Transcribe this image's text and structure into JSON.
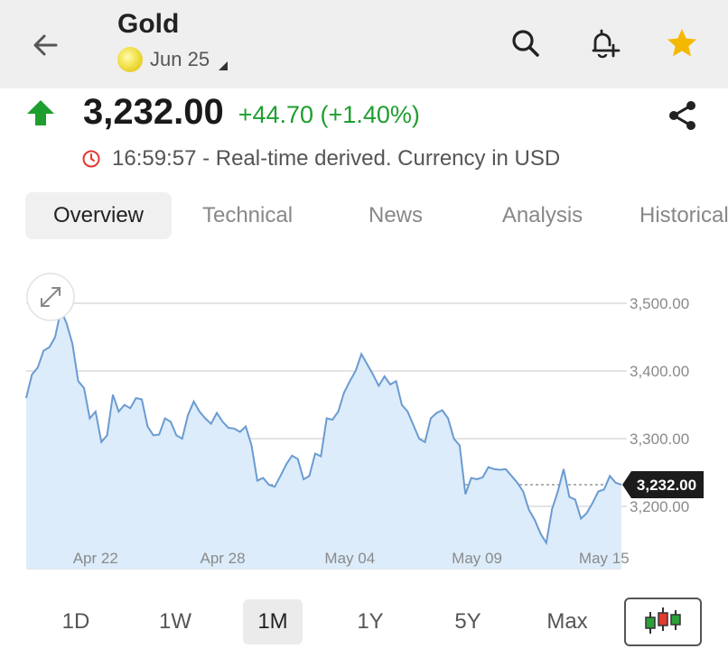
{
  "header": {
    "title": "Gold",
    "contract": "Jun 25",
    "icons": [
      "back-arrow-icon",
      "search-icon",
      "add-alert-icon",
      "star-icon"
    ],
    "star_color": "#f5b800"
  },
  "quote": {
    "price": "3,232.00",
    "change": "+44.70 (+1.40%)",
    "status": "16:59:57 - Real-time derived. Currency in USD",
    "up_color": "#1e9e2f"
  },
  "tabs": [
    {
      "label": "Overview",
      "active": true
    },
    {
      "label": "Technical",
      "active": false
    },
    {
      "label": "News",
      "active": false
    },
    {
      "label": "Analysis",
      "active": false
    },
    {
      "label": "Historical",
      "active": false
    }
  ],
  "ranges": [
    {
      "label": "1D",
      "active": false
    },
    {
      "label": "1W",
      "active": false
    },
    {
      "label": "1M",
      "active": true
    },
    {
      "label": "1Y",
      "active": false
    },
    {
      "label": "5Y",
      "active": false
    },
    {
      "label": "Max",
      "active": false
    }
  ],
  "chart_data": {
    "type": "area",
    "ylim": [
      3080,
      3560
    ],
    "y_ticks": [
      3200,
      3300,
      3400,
      3500
    ],
    "y_tick_labels": [
      "3,200.00",
      "3,300.00",
      "3,400.00",
      "3,500.00"
    ],
    "x_tick_labels": [
      "Apr 22",
      "Apr 28",
      "May 04",
      "May 09",
      "May 15"
    ],
    "x_tick_index": [
      12,
      34,
      56,
      78,
      100
    ],
    "last_value": 3232,
    "last_label": "3,232.00",
    "grid": true,
    "line_color": "#6b9bd1",
    "fill_color": "#dcecfb",
    "values": [
      3360,
      3395,
      3405,
      3430,
      3435,
      3450,
      3490,
      3470,
      3440,
      3385,
      3375,
      3330,
      3340,
      3295,
      3305,
      3365,
      3340,
      3350,
      3345,
      3360,
      3358,
      3318,
      3305,
      3306,
      3330,
      3325,
      3305,
      3300,
      3335,
      3355,
      3340,
      3330,
      3322,
      3338,
      3325,
      3316,
      3315,
      3310,
      3318,
      3290,
      3238,
      3242,
      3232,
      3229,
      3245,
      3262,
      3275,
      3270,
      3240,
      3245,
      3278,
      3274,
      3330,
      3328,
      3340,
      3368,
      3385,
      3400,
      3425,
      3410,
      3395,
      3378,
      3392,
      3380,
      3385,
      3350,
      3340,
      3320,
      3300,
      3295,
      3330,
      3338,
      3342,
      3330,
      3300,
      3290,
      3218,
      3242,
      3240,
      3243,
      3258,
      3255,
      3254,
      3255,
      3245,
      3235,
      3222,
      3195,
      3180,
      3160,
      3146,
      3196,
      3222,
      3255,
      3214,
      3210,
      3182,
      3190,
      3205,
      3222,
      3225,
      3245,
      3235,
      3232
    ]
  }
}
